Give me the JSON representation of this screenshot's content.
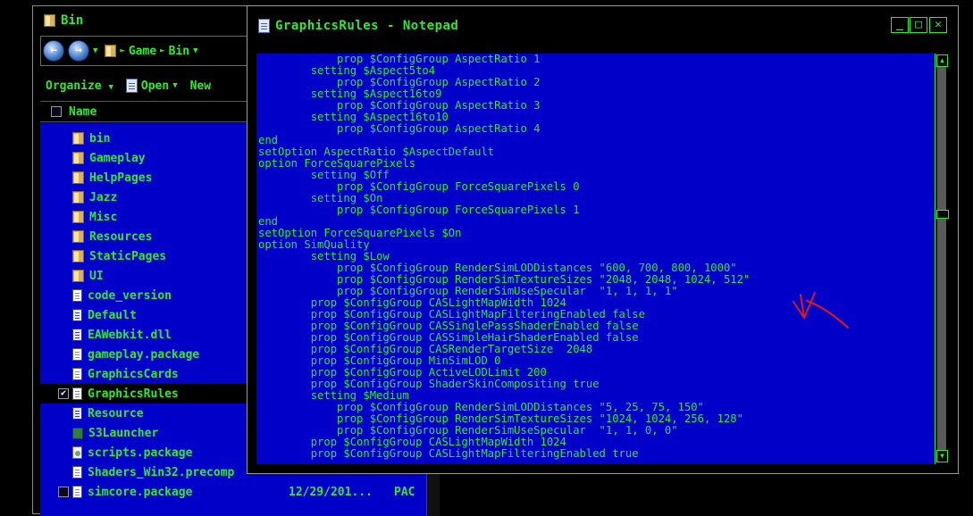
{
  "explorer": {
    "title": "Bin",
    "breadcrumb": [
      "Game",
      "Bin"
    ],
    "toolbar": {
      "organize": "Organize",
      "open": "Open",
      "new": "New"
    },
    "column_name": "Name",
    "files": [
      {
        "name": "bin",
        "icon": "folder-icon"
      },
      {
        "name": "Gameplay",
        "icon": "folder-icon"
      },
      {
        "name": "HelpPages",
        "icon": "folder-icon"
      },
      {
        "name": "Jazz",
        "icon": "folder-icon"
      },
      {
        "name": "Misc",
        "icon": "folder-icon"
      },
      {
        "name": "Resources",
        "icon": "folder-icon"
      },
      {
        "name": "StaticPages",
        "icon": "folder-icon"
      },
      {
        "name": "UI",
        "icon": "folder-icon"
      },
      {
        "name": "code_version",
        "icon": "file-icon"
      },
      {
        "name": "Default",
        "icon": "config-file-icon"
      },
      {
        "name": "EAWebkit.dll",
        "icon": "config-file-icon"
      },
      {
        "name": "gameplay.package",
        "icon": "file-icon"
      },
      {
        "name": "GraphicsCards",
        "icon": "file-icon"
      },
      {
        "name": "GraphicsRules",
        "icon": "file-icon",
        "selected": true
      },
      {
        "name": "Resource",
        "icon": "config-file-icon"
      },
      {
        "name": "S3Launcher",
        "icon": "application-icon"
      },
      {
        "name": "scripts.package",
        "icon": "package-icon"
      },
      {
        "name": "Shaders_Win32.precomp",
        "icon": "file-icon"
      },
      {
        "name": "simcore.package",
        "icon": "file-icon",
        "date": "12/29/201...",
        "type": "PAC"
      }
    ]
  },
  "notepad": {
    "title": "GraphicsRules - Notepad",
    "controls": {
      "minimize": "_",
      "maximize": "□",
      "close": "✕"
    },
    "lines": [
      "            prop $ConfigGroup AspectRatio 1",
      "        setting $Aspect5to4",
      "            prop $ConfigGroup AspectRatio 2",
      "        setting $Aspect16to9",
      "            prop $ConfigGroup AspectRatio 3",
      "        setting $Aspect16to10",
      "            prop $ConfigGroup AspectRatio 4",
      "end",
      "setOption AspectRatio $AspectDefault",
      "option ForceSquarePixels",
      "        setting $Off",
      "            prop $ConfigGroup ForceSquarePixels 0",
      "        setting $On",
      "            prop $ConfigGroup ForceSquarePixels 1",
      "end",
      "setOption ForceSquarePixels $On",
      "option SimQuality",
      "        setting $Low",
      "            prop $ConfigGroup RenderSimLODDistances \"600, 700, 800, 1000\"",
      "            prop $ConfigGroup RenderSimTextureSizes \"2048, 2048, 1024, 512\"",
      "            prop $ConfigGroup RenderSimUseSpecular  \"1, 1, 1, 1\"",
      "        prop $ConfigGroup CASLightMapWidth 1024",
      "        prop $ConfigGroup CASLightMapFilteringEnabled false",
      "        prop $ConfigGroup CASSinglePassShaderEnabled false",
      "        prop $ConfigGroup CASSimpleHairShaderEnabled false",
      "        prop $ConfigGroup CASRenderTargetSize  2048",
      "        prop $ConfigGroup MinSimLOD 0",
      "        prop $ConfigGroup ActiveLODLimit 200",
      "        prop $ConfigGroup ShaderSkinCompositing true",
      "        setting $Medium",
      "            prop $ConfigGroup RenderSimLODDistances \"5, 25, 75, 150\"",
      "            prop $ConfigGroup RenderSimTextureSizes \"1024, 1024, 256, 128\"",
      "            prop $ConfigGroup RenderSimUseSpecular  \"1, 1, 0, 0\"",
      "        prop $ConfigGroup CASLightMapWidth 1024",
      "        prop $ConfigGroup CASLightMapFilteringEnabled true"
    ]
  },
  "colors": {
    "background": "#000000",
    "text_green": "#35e635",
    "panel_blue": "#0000c8",
    "annotation_red": "#e01818"
  }
}
